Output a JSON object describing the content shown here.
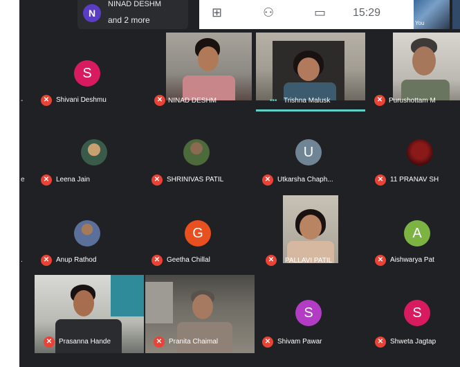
{
  "header": {
    "participants_avatar_letter": "N",
    "participants_line1": "NINAD DESHM",
    "participants_line2": "and 2 more",
    "time": "15:29",
    "self_label": "You"
  },
  "participants": [
    {
      "name": "Shivani Deshmu",
      "initial": "S",
      "color": "#d81b60"
    },
    {
      "name": "NINAD DESHM"
    },
    {
      "name": "Trishna Malusk"
    },
    {
      "name": "Purushottam M"
    },
    {
      "name": "Leena Jain"
    },
    {
      "name": "SHRINIVAS PATIL"
    },
    {
      "name": "Utkarsha Chaph...",
      "initial": "U",
      "color": "#6f8596"
    },
    {
      "name": "11 PRANAV SH"
    },
    {
      "name": "Anup Rathod"
    },
    {
      "name": "Geetha Chillal",
      "initial": "G",
      "color": "#e8511f"
    },
    {
      "name": "PALLAVI PATIL"
    },
    {
      "name": "Aishwarya Pat",
      "initial": "A",
      "color": "#7cb342"
    },
    {
      "name": "Prasanna Hande"
    },
    {
      "name": "Pranita Chaimal"
    },
    {
      "name": "Shivam Pawar",
      "initial": "S",
      "color": "#b23cc4"
    },
    {
      "name": "Shweta Jagtap",
      "initial": "S",
      "color": "#d81b60"
    }
  ],
  "icons": {
    "mic_off": "mic-off-icon",
    "camera": "camera-icon",
    "chat": "chat-icon",
    "people": "people-icon"
  }
}
